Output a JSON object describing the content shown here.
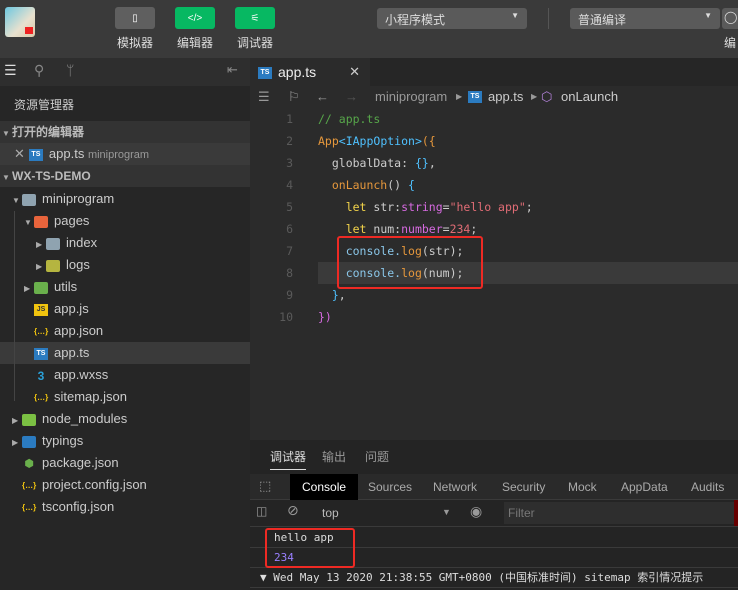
{
  "toolbar": {
    "buttons": [
      {
        "label": "模拟器",
        "glyph": "▯",
        "color": "#5f5f5f"
      },
      {
        "label": "编辑器",
        "glyph": "</>",
        "color": "#07b862"
      },
      {
        "label": "调试器",
        "glyph": "⚟",
        "color": "#07b862"
      }
    ],
    "mode_select": "小程序模式",
    "compile_select": "普通编译",
    "cut_label": "编"
  },
  "sidebar": {
    "title": "资源管理器",
    "open_editors": "打开的编辑器",
    "open_file": {
      "name": "app.ts",
      "folder": "miniprogram"
    },
    "project": "WX-TS-DEMO",
    "tree": [
      {
        "name": "miniprogram",
        "depth": 1,
        "arrow": "▼",
        "icon": "folder",
        "color": "#8fa3b0"
      },
      {
        "name": "pages",
        "depth": 2,
        "arrow": "▼",
        "icon": "folder-pages",
        "color": "#e8643c"
      },
      {
        "name": "index",
        "depth": 3,
        "arrow": "▶",
        "icon": "folder",
        "color": "#8fa3b0"
      },
      {
        "name": "logs",
        "depth": 3,
        "arrow": "▶",
        "icon": "folder-logs",
        "color": "#b5b540"
      },
      {
        "name": "utils",
        "depth": 2,
        "arrow": "▶",
        "icon": "folder-utils",
        "color": "#6ab04c"
      },
      {
        "name": "app.js",
        "depth": 2,
        "arrow": "",
        "icon": "js",
        "color": "#f1c40f"
      },
      {
        "name": "app.json",
        "depth": 2,
        "arrow": "",
        "icon": "json",
        "color": "#f1c40f"
      },
      {
        "name": "app.ts",
        "depth": 2,
        "arrow": "",
        "icon": "ts",
        "color": "#2b7bc0",
        "selected": true
      },
      {
        "name": "app.wxss",
        "depth": 2,
        "arrow": "",
        "icon": "css",
        "color": "#2a9fd6"
      },
      {
        "name": "sitemap.json",
        "depth": 2,
        "arrow": "",
        "icon": "json",
        "color": "#f1c40f"
      },
      {
        "name": "node_modules",
        "depth": 1,
        "arrow": "▶",
        "icon": "folder-node",
        "color": "#7bc043"
      },
      {
        "name": "typings",
        "depth": 1,
        "arrow": "▶",
        "icon": "folder-ts",
        "color": "#2b7bc0"
      },
      {
        "name": "package.json",
        "depth": 1,
        "arrow": "",
        "icon": "node",
        "color": "#6ab04c"
      },
      {
        "name": "project.config.json",
        "depth": 1,
        "arrow": "",
        "icon": "json",
        "color": "#f1c40f"
      },
      {
        "name": "tsconfig.json",
        "depth": 1,
        "arrow": "",
        "icon": "json",
        "color": "#f1c40f"
      }
    ]
  },
  "editor": {
    "tab": "app.ts",
    "breadcrumb": [
      "miniprogram",
      "app.ts",
      "onLaunch"
    ],
    "lines": [
      [
        [
          "comment",
          "// app.ts"
        ]
      ],
      [
        [
          "fn",
          "App"
        ],
        [
          "type",
          "<IAppOption>"
        ],
        [
          "fn",
          "({"
        ]
      ],
      [
        [
          "var",
          "  globalData"
        ],
        [
          "var",
          ": "
        ],
        [
          "punc",
          "{}"
        ],
        [
          "var",
          ","
        ]
      ],
      [
        [
          "fn",
          "  onLaunch"
        ],
        [
          "var",
          "() "
        ],
        [
          "punc",
          "{"
        ]
      ],
      [
        [
          "kw",
          "    let "
        ],
        [
          "var",
          "str:"
        ],
        [
          "tp",
          "string"
        ],
        [
          "var",
          "="
        ],
        [
          "str",
          "\"hello app\""
        ],
        [
          "var",
          ";"
        ]
      ],
      [
        [
          "kw",
          "    let "
        ],
        [
          "var",
          "num:"
        ],
        [
          "tp",
          "number"
        ],
        [
          "var",
          "="
        ],
        [
          "num",
          "234"
        ],
        [
          "var",
          ";"
        ]
      ],
      [
        [
          "id",
          "    console."
        ],
        [
          "fn",
          "log"
        ],
        [
          "var",
          "(str);"
        ]
      ],
      [
        [
          "id",
          "    console."
        ],
        [
          "fn",
          "log"
        ],
        [
          "var",
          "(num);"
        ]
      ],
      [
        [
          "punc",
          "  }"
        ],
        [
          "var",
          ","
        ]
      ],
      [
        [
          "tp",
          "})"
        ]
      ]
    ]
  },
  "panel": {
    "tabs": [
      "调试器",
      "输出",
      "问题"
    ],
    "devtools_tabs": [
      "Console",
      "Sources",
      "Network",
      "Security",
      "Mock",
      "AppData",
      "Audits"
    ],
    "context": "top",
    "filter_placeholder": "Filter",
    "console": [
      {
        "text": "hello app",
        "color": "#dddddd"
      },
      {
        "text": "234",
        "color": "#9980ff"
      },
      {
        "text": "▼ Wed May 13 2020 21:38:55 GMT+0800 (中国标准时间) sitemap 索引情况提示",
        "color": "#dddddd"
      }
    ]
  }
}
